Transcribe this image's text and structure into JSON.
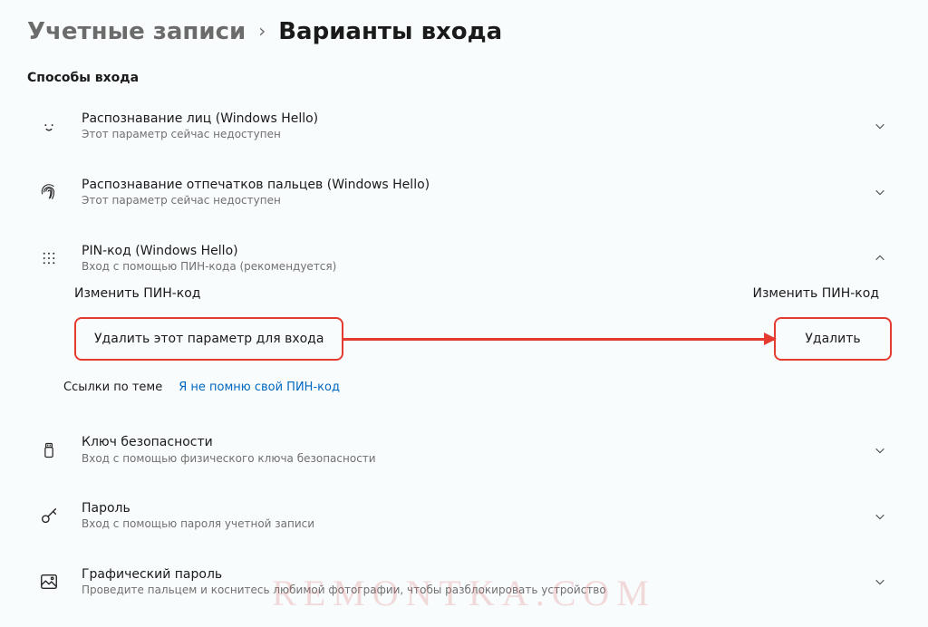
{
  "breadcrumb": {
    "parent": "Учетные записи",
    "current": "Варианты входа"
  },
  "section_title": "Способы входа",
  "options": {
    "face": {
      "title": "Распознавание лиц (Windows Hello)",
      "subtitle": "Этот параметр сейчас недоступен"
    },
    "fingerprint": {
      "title": "Распознавание отпечатков пальцев (Windows Hello)",
      "subtitle": "Этот параметр сейчас недоступен"
    },
    "pin": {
      "title": "PIN-код (Windows Hello)",
      "subtitle": "Вход с помощью ПИН-кода (рекомендуется)",
      "change_left": "Изменить ПИН-код",
      "change_right": "Изменить ПИН-код",
      "remove_left": "Удалить этот параметр для входа",
      "remove_right": "Удалить"
    },
    "security_key": {
      "title": "Ключ безопасности",
      "subtitle": "Вход с помощью физического ключа безопасности"
    },
    "password": {
      "title": "Пароль",
      "subtitle": "Вход с помощью пароля учетной записи"
    },
    "picture_password": {
      "title": "Графический пароль",
      "subtitle": "Проведите пальцем и коснитесь любимой фотографии, чтобы разблокировать устройство"
    }
  },
  "links": {
    "label": "Ссылки по теме",
    "forgot_pin": "Я не помню свой ПИН-код"
  },
  "watermark": "REMONTKA.COM",
  "colors": {
    "highlight": "#e33b2e",
    "link": "#0067c0"
  }
}
